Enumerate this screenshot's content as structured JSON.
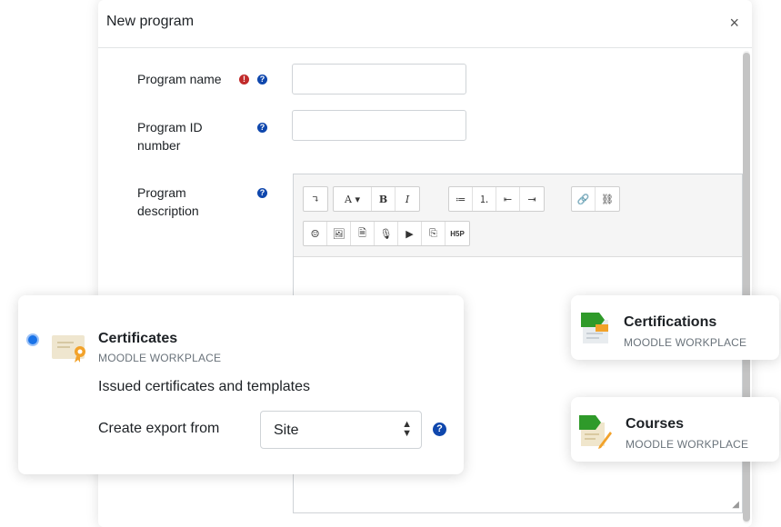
{
  "modal": {
    "title": "New program",
    "close": "×"
  },
  "form": {
    "program_name_label": "Program name",
    "program_id_label_line1": "Program ID",
    "program_id_label_line2": "number",
    "program_desc_label_line1": "Program",
    "program_desc_label_line2": "description",
    "program_name_value": "",
    "program_id_value": ""
  },
  "editor": {
    "toolbar_row1": [
      "↴",
      "A ▾",
      "B",
      "I",
      "≔",
      "⒈",
      "⇤",
      "⇥",
      "🔗",
      "⛓"
    ],
    "toolbar_row2": [
      "☺",
      "🖼",
      "🗎",
      "🎙",
      "▶",
      "⎘",
      "H5P"
    ]
  },
  "cards": {
    "certificates": {
      "title": "Certificates",
      "subtitle": "MOODLE WORKPLACE",
      "description": "Issued certificates and templates",
      "export_label": "Create export from",
      "export_value": "Site",
      "selected": true
    },
    "certifications": {
      "title": "Certifications",
      "subtitle": "MOODLE WORKPLACE"
    },
    "courses": {
      "title": "Courses",
      "subtitle": "MOODLE WORKPLACE"
    }
  },
  "colors": {
    "help_icon": "#0f47ad",
    "required_icon": "#c12a2a",
    "radio_selected": "#1a73e8",
    "workplace_green": "#3a9a2e"
  }
}
